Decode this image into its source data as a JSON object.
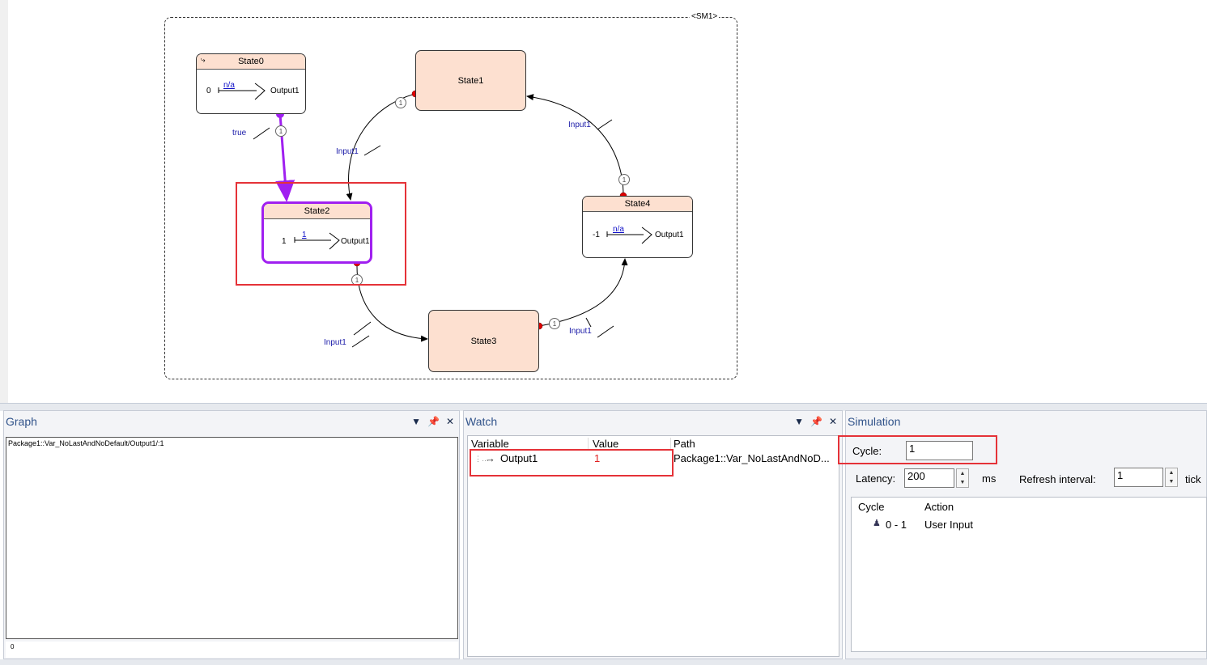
{
  "diagram": {
    "machine_label": "<SM1>",
    "states": {
      "state0": {
        "name": "State0",
        "init": "0",
        "action": "n/a",
        "output": "Output1"
      },
      "state1": {
        "name": "State1"
      },
      "state2": {
        "name": "State2",
        "init": "1",
        "action": "1",
        "output": "Output1"
      },
      "state3": {
        "name": "State3"
      },
      "state4": {
        "name": "State4",
        "init": "-1",
        "action": "n/a",
        "output": "Output1"
      }
    },
    "transition_labels": {
      "s0_s2": "true",
      "s1_s2": "Input1",
      "s2_s3": "Input1",
      "s3_s4": "Input1",
      "s4_s1": "Input1"
    },
    "priority": "1",
    "colors": {
      "active": "#a020f0",
      "state_fill": "#fde0d0",
      "event_dot": "#e00000",
      "highlight": "#e53238"
    }
  },
  "graph_panel": {
    "title": "Graph",
    "signal_text": "Package1::Var_NoLastAndNoDefault/Output1/:1",
    "footer": "0"
  },
  "watch_panel": {
    "title": "Watch",
    "columns": {
      "variable": "Variable",
      "value": "Value",
      "path": "Path"
    },
    "row": {
      "variable": "Output1",
      "value": "1",
      "path": "Package1::Var_NoLastAndNoD..."
    }
  },
  "simulation_panel": {
    "title": "Simulation",
    "cycle_label": "Cycle:",
    "cycle_value": "1",
    "latency_label": "Latency:",
    "latency_value": "200",
    "latency_unit": "ms",
    "refresh_label": "Refresh interval:",
    "refresh_value": "1",
    "refresh_unit": "tick",
    "list_columns": {
      "cycle": "Cycle",
      "action": "Action"
    },
    "list_row": {
      "cycle": "0 - 1",
      "action": "User Input"
    }
  },
  "icons": [
    "dropdown-icon",
    "pin-icon",
    "close-icon",
    "user-input-icon",
    "arrow-icon"
  ]
}
